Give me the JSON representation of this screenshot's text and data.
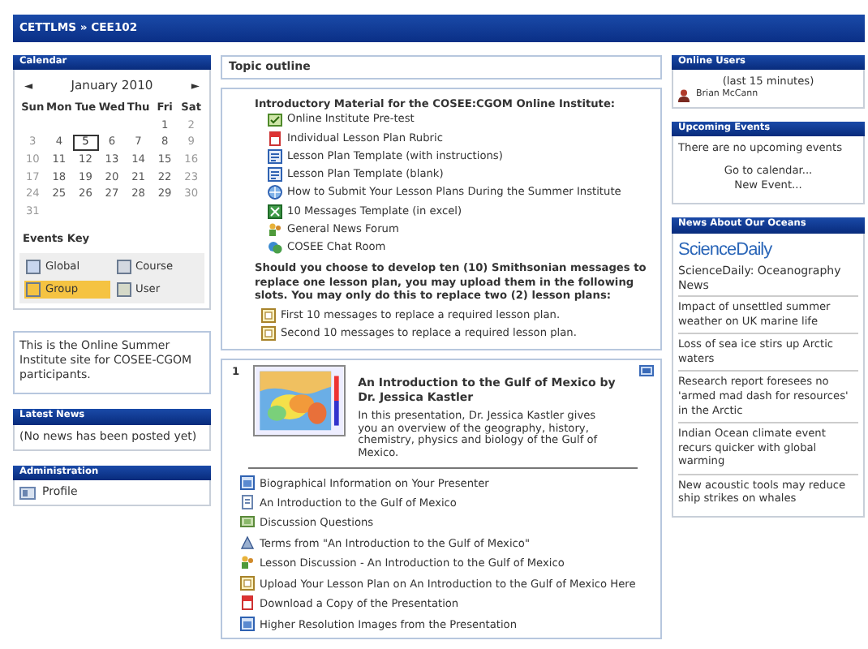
{
  "header": {
    "breadcrumb": "CETTLMS » CEE102"
  },
  "calendar": {
    "title": "Calendar",
    "prev": "◄",
    "month": "January 2010",
    "next": "►",
    "weekdays": [
      "Sun",
      "Mon",
      "Tue",
      "Wed",
      "Thu",
      "Fri",
      "Sat"
    ],
    "weeks": [
      [
        {
          "d": "1",
          "today": false
        },
        {
          "d": "2",
          "today": false
        }
      ],
      [
        {
          "d": "3",
          "today": false
        },
        {
          "d": "4",
          "today": false
        },
        {
          "d": "5",
          "today": true
        },
        {
          "d": "6",
          "today": false
        },
        {
          "d": "7",
          "today": false
        },
        {
          "d": "8",
          "today": false
        },
        {
          "d": "9",
          "today": false
        }
      ],
      [
        {
          "d": "10",
          "today": false
        },
        {
          "d": "11",
          "today": false
        },
        {
          "d": "12",
          "today": false
        },
        {
          "d": "13",
          "today": false
        },
        {
          "d": "14",
          "today": false
        },
        {
          "d": "15",
          "today": false
        },
        {
          "d": "16",
          "today": false
        }
      ],
      [
        {
          "d": "17",
          "today": false
        },
        {
          "d": "18",
          "today": false
        },
        {
          "d": "19",
          "today": false
        },
        {
          "d": "20",
          "today": false
        },
        {
          "d": "21",
          "today": false
        },
        {
          "d": "22",
          "today": false
        },
        {
          "d": "23",
          "today": false
        }
      ],
      [
        {
          "d": "24",
          "today": false
        },
        {
          "d": "25",
          "today": false
        },
        {
          "d": "26",
          "today": false
        },
        {
          "d": "27",
          "today": false
        },
        {
          "d": "28",
          "today": false
        },
        {
          "d": "29",
          "today": false
        },
        {
          "d": "30",
          "today": false
        }
      ],
      [
        {
          "d": "31",
          "today": false
        }
      ]
    ],
    "events_key_title": "Events Key",
    "events_key": [
      {
        "label": "Global",
        "color": "#c8d6ee",
        "highlighted": false
      },
      {
        "label": "Course",
        "color": "#d3d8e0",
        "highlighted": false
      },
      {
        "label": "Group",
        "color": "#f5c342",
        "highlighted": true
      },
      {
        "label": "User",
        "color": "#d5d9c8",
        "highlighted": false
      }
    ]
  },
  "summary": "This is the Online Summer Institute site for COSEE-CGOM participants.",
  "latest_news": {
    "title": "Latest News",
    "text": "(No news has been posted yet)"
  },
  "administration": {
    "title": "Administration",
    "items": [
      {
        "label": "Profile"
      }
    ]
  },
  "topic_outline": {
    "title": "Topic outline",
    "section_0": {
      "heading": "Introductory Material for the COSEE:CGOM Online Institute:",
      "items": [
        {
          "kind": "quiz",
          "label": "Online Institute Pre-test"
        },
        {
          "kind": "pdf",
          "label": "Individual Lesson Plan Rubric"
        },
        {
          "kind": "doc",
          "label": "Lesson Plan Template (with instructions)"
        },
        {
          "kind": "doc",
          "label": "Lesson Plan Template (blank)"
        },
        {
          "kind": "link",
          "label": "How to Submit Your Lesson Plans During the Summer Institute"
        },
        {
          "kind": "excel",
          "label": "10 Messages Template (in excel)"
        },
        {
          "kind": "forum",
          "label": "General News Forum"
        },
        {
          "kind": "chat",
          "label": "COSEE Chat Room"
        }
      ],
      "note": "Should you choose to develop ten (10) Smithsonian messages to replace one lesson plan, you may upload them in the following slots. You may only do this to replace two (2) lesson plans:",
      "slots": [
        {
          "kind": "assignment",
          "label": "First 10 messages to replace a required lesson plan."
        },
        {
          "kind": "assignment",
          "label": "Second 10 messages to replace a required lesson plan."
        }
      ]
    },
    "section_1": {
      "number": "1",
      "title": "An Introduction to the Gulf of Mexico by Dr. Jessica Kastler",
      "description": "In this presentation, Dr. Jessica Kastler gives you an overview of the geography, history, chemistry, physics and biology of the Gulf of Mexico.",
      "items": [
        {
          "kind": "slides",
          "label": "Biographical Information on Your Presenter"
        },
        {
          "kind": "page",
          "label": "An Introduction to the Gulf of Mexico"
        },
        {
          "kind": "questions",
          "label": "Discussion Questions"
        },
        {
          "kind": "glossary",
          "label": "Terms from \"An Introduction to the Gulf of Mexico\""
        },
        {
          "kind": "forum",
          "label": "Lesson Discussion - An Introduction to the Gulf of Mexico"
        },
        {
          "kind": "assignment",
          "label": "Upload Your Lesson Plan on An Introduction to the Gulf of Mexico Here"
        },
        {
          "kind": "pdf",
          "label": "Download a Copy of the Presentation"
        },
        {
          "kind": "slides",
          "label": "Higher Resolution Images from the Presentation"
        }
      ]
    }
  },
  "online_users": {
    "title": "Online Users",
    "period": "(last 15 minutes)",
    "users": [
      "Brian McCann"
    ]
  },
  "upcoming_events": {
    "title": "Upcoming Events",
    "text": "There are no upcoming events",
    "links": [
      "Go to calendar...",
      "New Event..."
    ]
  },
  "news": {
    "title": "News About Our Oceans",
    "logo": "ScienceDaily",
    "feed": "ScienceDaily: Oceanography News",
    "items": [
      "Impact of unsettled summer weather on UK marine life",
      "Loss of sea ice stirs up Arctic waters",
      "Research report foresees no 'armed mad dash for resources' in the Arctic",
      "Indian Ocean climate event recurs quicker with global warming",
      "New acoustic tools may reduce ship strikes on whales"
    ]
  }
}
